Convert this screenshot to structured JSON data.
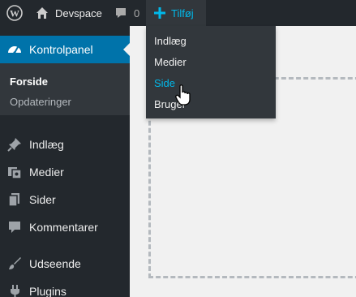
{
  "adminbar": {
    "wp_icon": "wordpress-logo-icon",
    "site_icon": "home-icon",
    "site_name": "Devspace",
    "comments_icon": "comment-bubble-icon",
    "comments_count": "0",
    "new_icon": "plus-icon",
    "new_label": "Tilføj"
  },
  "new_menu": {
    "items": [
      {
        "label": "Indlæg"
      },
      {
        "label": "Medier"
      },
      {
        "label": "Side"
      },
      {
        "label": "Bruger"
      }
    ],
    "hovered_index": 2
  },
  "sidebar": {
    "dashboard": {
      "label": "Kontrolpanel",
      "icon": "gauge-icon"
    },
    "submenu": [
      {
        "label": "Forside"
      },
      {
        "label": "Opdateringer"
      }
    ],
    "items": [
      {
        "label": "Indlæg",
        "icon": "pushpin-icon"
      },
      {
        "label": "Medier",
        "icon": "media-icon"
      },
      {
        "label": "Sider",
        "icon": "pages-icon"
      },
      {
        "label": "Kommentarer",
        "icon": "comment-icon"
      },
      {
        "label": "Udseende",
        "icon": "brush-icon"
      },
      {
        "label": "Plugins",
        "icon": "plug-icon"
      }
    ]
  },
  "colors": {
    "bar_bg": "#23282d",
    "submenu_bg": "#32373c",
    "accent": "#0073aa",
    "highlight": "#00b9eb",
    "content_bg": "#f1f1f1"
  }
}
